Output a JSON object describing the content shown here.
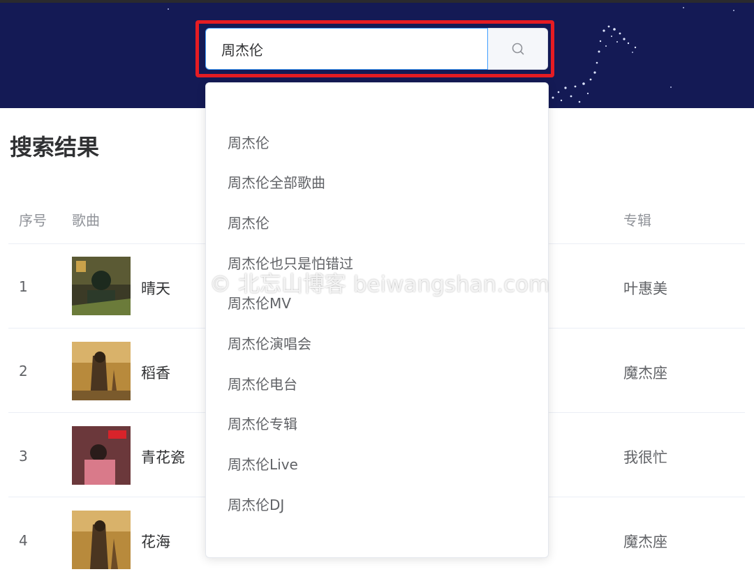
{
  "search": {
    "value": "周杰伦",
    "button_icon": "search-icon"
  },
  "results": {
    "title": "搜索结果",
    "columns": {
      "index": "序号",
      "song": "歌曲",
      "album": "专辑"
    },
    "rows": [
      {
        "index": "1",
        "song": "晴天",
        "album": "叶惠美"
      },
      {
        "index": "2",
        "song": "稻香",
        "album": "魔杰座"
      },
      {
        "index": "3",
        "song": "青花瓷",
        "album": "我很忙"
      },
      {
        "index": "4",
        "song": "花海",
        "album": "魔杰座"
      }
    ]
  },
  "suggestions": [
    "周杰伦",
    "周杰伦全部歌曲",
    "周杰伦",
    "周杰伦也只是怕错过",
    "周杰伦MV",
    "周杰伦演唱会",
    "周杰伦电台",
    "周杰伦专辑",
    "周杰伦Live",
    "周杰伦DJ"
  ],
  "watermark": "© 北忘山博客 beiwangshan.com",
  "colors": {
    "banner": "#141a55",
    "highlight_frame": "#e51c23",
    "input_focus": "#409eff"
  }
}
